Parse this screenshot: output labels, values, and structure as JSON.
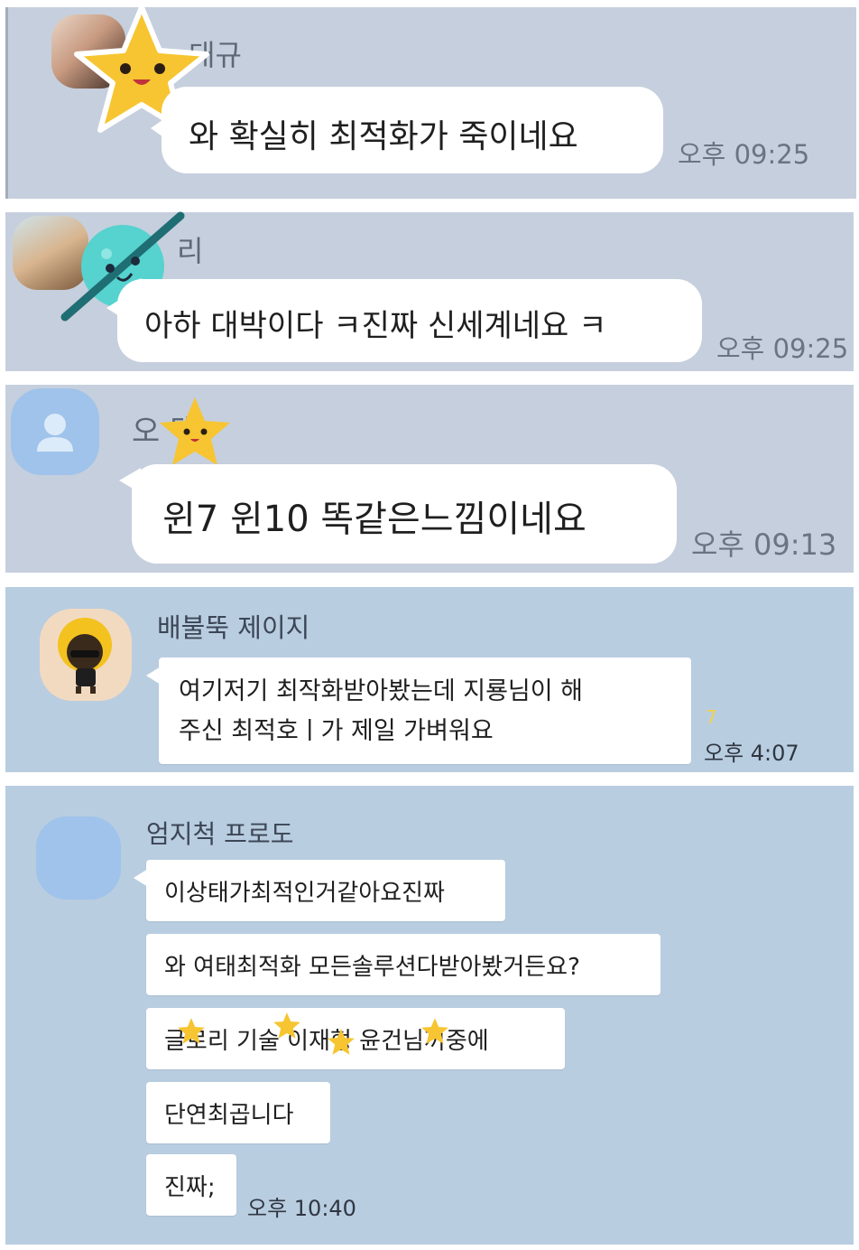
{
  "messages": [
    {
      "sender": "태규",
      "text": "와 확실히 최적화가 죽이네요",
      "time": "오후 09:25"
    },
    {
      "sender": "리",
      "text": "아하 대박이다 ㅋ진짜 신세계네요 ㅋ",
      "time": "오후 09:25"
    },
    {
      "sender": "오 택",
      "text": "윈7 윈10 똑같은느낌이네요",
      "time": "오후 09:13"
    },
    {
      "sender": "배불뚝 제이지",
      "line1": "여기저기 최작화받아봤는데 지룡님이 해",
      "line2": "주신 최적호ㅣ가 제일 가벼워요",
      "unread": "7",
      "time": "오후 4:07"
    },
    {
      "sender": "엄지척 프로도",
      "bubbles": [
        "이상태가최적인거같아요진짜",
        "와 여태최적화 모든솔루션다받아봤거든요?",
        "글로리 기술 이재형 윤건님꺼중에",
        "단연최곱니다",
        "진짜;"
      ],
      "time": "오후 10:40"
    }
  ],
  "colors": {
    "panel_gray": "#c6cfdd",
    "panel_blue": "#b9cde0",
    "bubble": "#ffffff",
    "star": "#f7c531",
    "planet": "#56d2cf",
    "default_avatar": "#9fc3ea"
  }
}
